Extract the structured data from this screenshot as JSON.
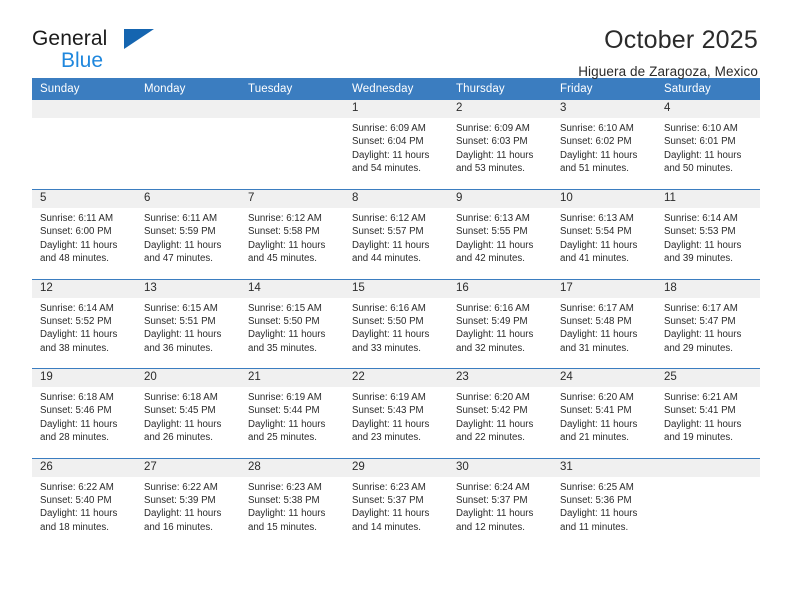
{
  "brand": {
    "name_part1": "General",
    "name_part2": "Blue",
    "triangle_icon": "triangle-icon",
    "accent_dark": "#1565b0",
    "accent_light": "#1f87dd"
  },
  "header": {
    "title": "October 2025",
    "subtitle": "Higuera de Zaragoza, Mexico"
  },
  "theme": {
    "header_row_bg": "#3b7dc0",
    "daynum_band_bg": "#f0f0f0",
    "grid_line": "#3b7dc0",
    "text": "#2b2b2b"
  },
  "weekday_headers": [
    "Sunday",
    "Monday",
    "Tuesday",
    "Wednesday",
    "Thursday",
    "Friday",
    "Saturday"
  ],
  "weeks": [
    [
      {
        "empty": true
      },
      {
        "empty": true
      },
      {
        "empty": true
      },
      {
        "day": "1",
        "sunrise": "Sunrise: 6:09 AM",
        "sunset": "Sunset: 6:04 PM",
        "daylight_1": "Daylight: 11 hours",
        "daylight_2": "and 54 minutes."
      },
      {
        "day": "2",
        "sunrise": "Sunrise: 6:09 AM",
        "sunset": "Sunset: 6:03 PM",
        "daylight_1": "Daylight: 11 hours",
        "daylight_2": "and 53 minutes."
      },
      {
        "day": "3",
        "sunrise": "Sunrise: 6:10 AM",
        "sunset": "Sunset: 6:02 PM",
        "daylight_1": "Daylight: 11 hours",
        "daylight_2": "and 51 minutes."
      },
      {
        "day": "4",
        "sunrise": "Sunrise: 6:10 AM",
        "sunset": "Sunset: 6:01 PM",
        "daylight_1": "Daylight: 11 hours",
        "daylight_2": "and 50 minutes."
      }
    ],
    [
      {
        "day": "5",
        "sunrise": "Sunrise: 6:11 AM",
        "sunset": "Sunset: 6:00 PM",
        "daylight_1": "Daylight: 11 hours",
        "daylight_2": "and 48 minutes."
      },
      {
        "day": "6",
        "sunrise": "Sunrise: 6:11 AM",
        "sunset": "Sunset: 5:59 PM",
        "daylight_1": "Daylight: 11 hours",
        "daylight_2": "and 47 minutes."
      },
      {
        "day": "7",
        "sunrise": "Sunrise: 6:12 AM",
        "sunset": "Sunset: 5:58 PM",
        "daylight_1": "Daylight: 11 hours",
        "daylight_2": "and 45 minutes."
      },
      {
        "day": "8",
        "sunrise": "Sunrise: 6:12 AM",
        "sunset": "Sunset: 5:57 PM",
        "daylight_1": "Daylight: 11 hours",
        "daylight_2": "and 44 minutes."
      },
      {
        "day": "9",
        "sunrise": "Sunrise: 6:13 AM",
        "sunset": "Sunset: 5:55 PM",
        "daylight_1": "Daylight: 11 hours",
        "daylight_2": "and 42 minutes."
      },
      {
        "day": "10",
        "sunrise": "Sunrise: 6:13 AM",
        "sunset": "Sunset: 5:54 PM",
        "daylight_1": "Daylight: 11 hours",
        "daylight_2": "and 41 minutes."
      },
      {
        "day": "11",
        "sunrise": "Sunrise: 6:14 AM",
        "sunset": "Sunset: 5:53 PM",
        "daylight_1": "Daylight: 11 hours",
        "daylight_2": "and 39 minutes."
      }
    ],
    [
      {
        "day": "12",
        "sunrise": "Sunrise: 6:14 AM",
        "sunset": "Sunset: 5:52 PM",
        "daylight_1": "Daylight: 11 hours",
        "daylight_2": "and 38 minutes."
      },
      {
        "day": "13",
        "sunrise": "Sunrise: 6:15 AM",
        "sunset": "Sunset: 5:51 PM",
        "daylight_1": "Daylight: 11 hours",
        "daylight_2": "and 36 minutes."
      },
      {
        "day": "14",
        "sunrise": "Sunrise: 6:15 AM",
        "sunset": "Sunset: 5:50 PM",
        "daylight_1": "Daylight: 11 hours",
        "daylight_2": "and 35 minutes."
      },
      {
        "day": "15",
        "sunrise": "Sunrise: 6:16 AM",
        "sunset": "Sunset: 5:50 PM",
        "daylight_1": "Daylight: 11 hours",
        "daylight_2": "and 33 minutes."
      },
      {
        "day": "16",
        "sunrise": "Sunrise: 6:16 AM",
        "sunset": "Sunset: 5:49 PM",
        "daylight_1": "Daylight: 11 hours",
        "daylight_2": "and 32 minutes."
      },
      {
        "day": "17",
        "sunrise": "Sunrise: 6:17 AM",
        "sunset": "Sunset: 5:48 PM",
        "daylight_1": "Daylight: 11 hours",
        "daylight_2": "and 31 minutes."
      },
      {
        "day": "18",
        "sunrise": "Sunrise: 6:17 AM",
        "sunset": "Sunset: 5:47 PM",
        "daylight_1": "Daylight: 11 hours",
        "daylight_2": "and 29 minutes."
      }
    ],
    [
      {
        "day": "19",
        "sunrise": "Sunrise: 6:18 AM",
        "sunset": "Sunset: 5:46 PM",
        "daylight_1": "Daylight: 11 hours",
        "daylight_2": "and 28 minutes."
      },
      {
        "day": "20",
        "sunrise": "Sunrise: 6:18 AM",
        "sunset": "Sunset: 5:45 PM",
        "daylight_1": "Daylight: 11 hours",
        "daylight_2": "and 26 minutes."
      },
      {
        "day": "21",
        "sunrise": "Sunrise: 6:19 AM",
        "sunset": "Sunset: 5:44 PM",
        "daylight_1": "Daylight: 11 hours",
        "daylight_2": "and 25 minutes."
      },
      {
        "day": "22",
        "sunrise": "Sunrise: 6:19 AM",
        "sunset": "Sunset: 5:43 PM",
        "daylight_1": "Daylight: 11 hours",
        "daylight_2": "and 23 minutes."
      },
      {
        "day": "23",
        "sunrise": "Sunrise: 6:20 AM",
        "sunset": "Sunset: 5:42 PM",
        "daylight_1": "Daylight: 11 hours",
        "daylight_2": "and 22 minutes."
      },
      {
        "day": "24",
        "sunrise": "Sunrise: 6:20 AM",
        "sunset": "Sunset: 5:41 PM",
        "daylight_1": "Daylight: 11 hours",
        "daylight_2": "and 21 minutes."
      },
      {
        "day": "25",
        "sunrise": "Sunrise: 6:21 AM",
        "sunset": "Sunset: 5:41 PM",
        "daylight_1": "Daylight: 11 hours",
        "daylight_2": "and 19 minutes."
      }
    ],
    [
      {
        "day": "26",
        "sunrise": "Sunrise: 6:22 AM",
        "sunset": "Sunset: 5:40 PM",
        "daylight_1": "Daylight: 11 hours",
        "daylight_2": "and 18 minutes."
      },
      {
        "day": "27",
        "sunrise": "Sunrise: 6:22 AM",
        "sunset": "Sunset: 5:39 PM",
        "daylight_1": "Daylight: 11 hours",
        "daylight_2": "and 16 minutes."
      },
      {
        "day": "28",
        "sunrise": "Sunrise: 6:23 AM",
        "sunset": "Sunset: 5:38 PM",
        "daylight_1": "Daylight: 11 hours",
        "daylight_2": "and 15 minutes."
      },
      {
        "day": "29",
        "sunrise": "Sunrise: 6:23 AM",
        "sunset": "Sunset: 5:37 PM",
        "daylight_1": "Daylight: 11 hours",
        "daylight_2": "and 14 minutes."
      },
      {
        "day": "30",
        "sunrise": "Sunrise: 6:24 AM",
        "sunset": "Sunset: 5:37 PM",
        "daylight_1": "Daylight: 11 hours",
        "daylight_2": "and 12 minutes."
      },
      {
        "day": "31",
        "sunrise": "Sunrise: 6:25 AM",
        "sunset": "Sunset: 5:36 PM",
        "daylight_1": "Daylight: 11 hours",
        "daylight_2": "and 11 minutes."
      },
      {
        "empty": true
      }
    ]
  ]
}
